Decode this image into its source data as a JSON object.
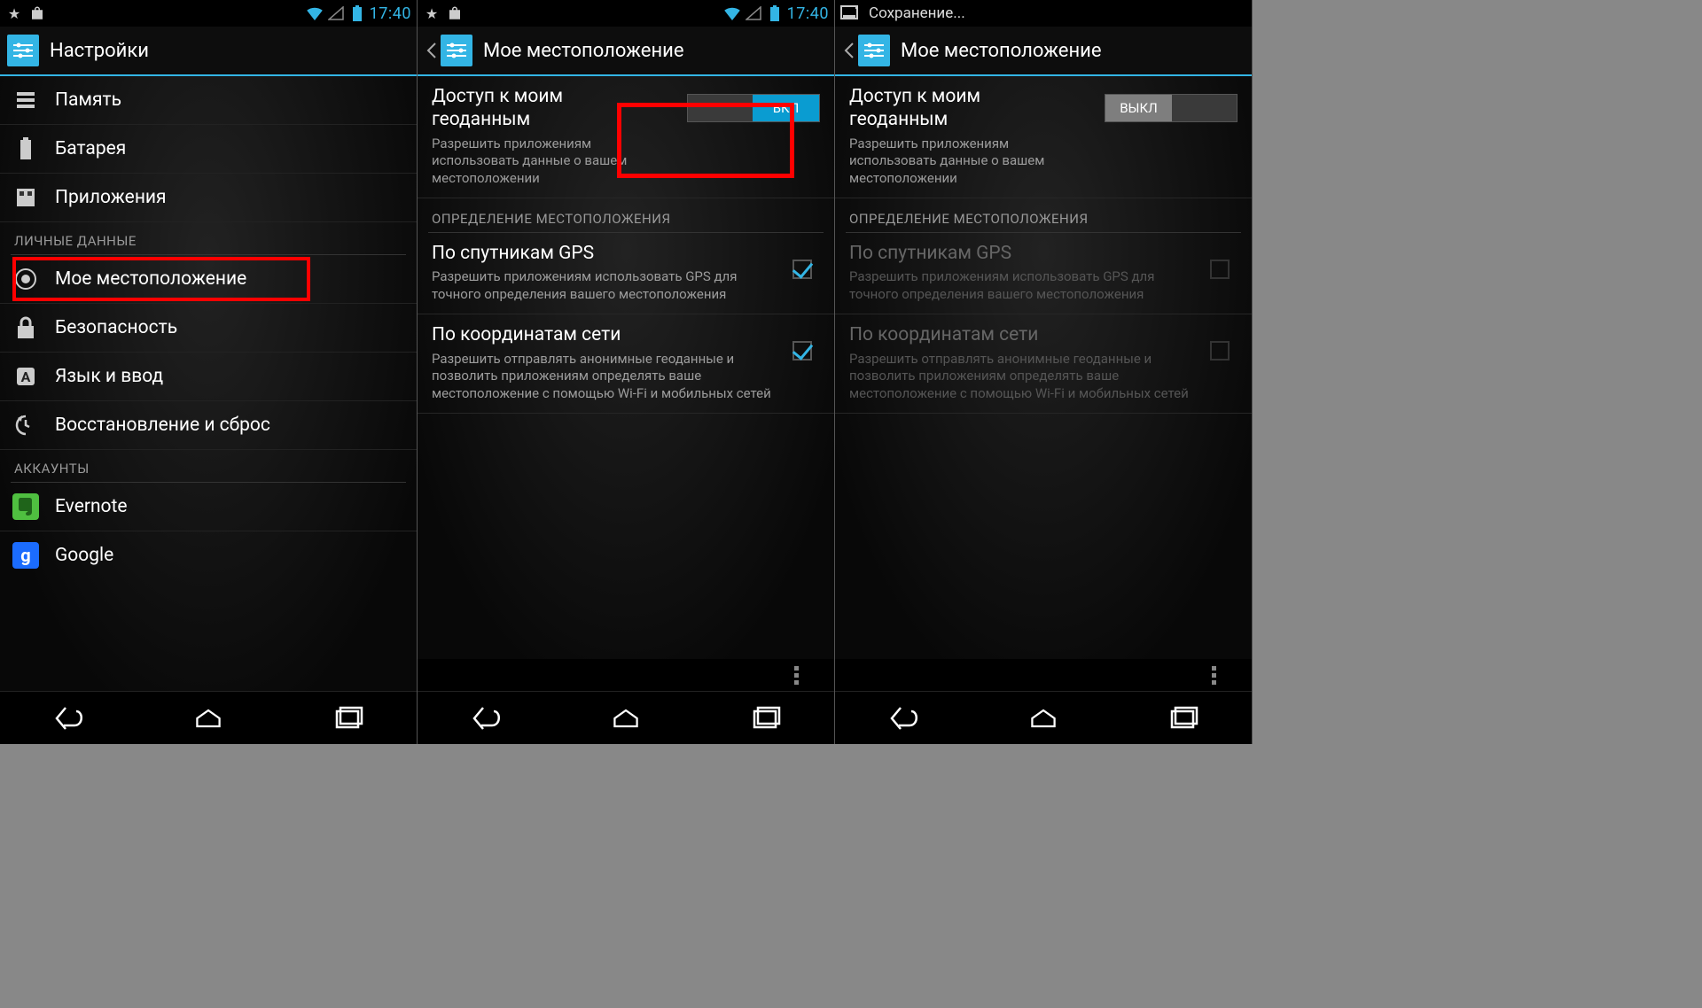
{
  "status": {
    "time": "17:40",
    "saving_text": "Сохранение..."
  },
  "screen1": {
    "title": "Настройки",
    "items": {
      "storage": "Память",
      "battery": "Батарея",
      "apps": "Приложения",
      "location": "Мое местоположение",
      "security": "Безопасность",
      "language": "Язык и ввод",
      "backup": "Восстановление и сброс",
      "evernote": "Evernote",
      "google": "Google"
    },
    "sections": {
      "personal": "ЛИЧНЫЕ ДАННЫЕ",
      "accounts": "АККАУНТЫ"
    }
  },
  "screen2": {
    "title": "Мое местоположение",
    "access": {
      "title": "Доступ к моим геоданным",
      "sub": "Разрешить приложениям использовать данные о вашем местоположении",
      "switch": "ВКЛ"
    },
    "section_loc": "ОПРЕДЕЛЕНИЕ МЕСТОПОЛОЖЕНИЯ",
    "gps": {
      "title": "По спутникам GPS",
      "sub": "Разрешить приложениям использовать GPS для точного определения вашего местоположения"
    },
    "net": {
      "title": "По координатам сети",
      "sub": "Разрешить отправлять анонимные геоданные и позволить приложениям определять ваше местоположение с помощью Wi-Fi и мобильных сетей"
    }
  },
  "screen3": {
    "title": "Мое местоположение",
    "access": {
      "title": "Доступ к моим геоданным",
      "sub": "Разрешить приложениям использовать данные о вашем местоположении",
      "switch": "ВЫКЛ"
    },
    "section_loc": "ОПРЕДЕЛЕНИЕ МЕСТОПОЛОЖЕНИЯ",
    "gps": {
      "title": "По спутникам GPS",
      "sub": "Разрешить приложениям использовать GPS для точного определения вашего местоположения"
    },
    "net": {
      "title": "По координатам сети",
      "sub": "Разрешить отправлять анонимные геоданные и позволить приложениям определять ваше местоположение с помощью Wi-Fi и мобильных сетей"
    }
  }
}
